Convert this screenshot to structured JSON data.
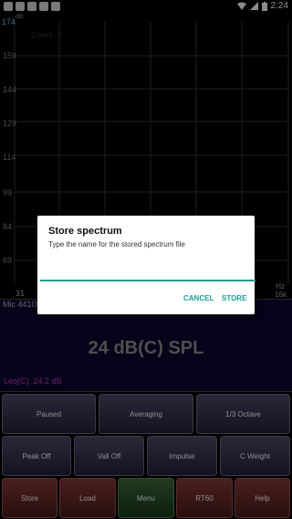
{
  "status_bar": {
    "time": "2:24"
  },
  "graph": {
    "y_top": "174",
    "y_top_unit": "dB",
    "y_ticks": [
      "159",
      "144",
      "129",
      "114",
      "99",
      "84",
      "69"
    ],
    "count": "Count: 0",
    "x_left": "31",
    "x_right_top": "Hz",
    "x_right_bottom": "16k"
  },
  "meter": {
    "mic": "Mic 44100",
    "spl": "24 dB(C) SPL",
    "leq": "Leq(C): 24.2 dB"
  },
  "buttons": {
    "row1": [
      "Paused",
      "Averaging",
      "1/3 Octave"
    ],
    "row2": [
      "Peak Off",
      "Vall Off",
      "Impulse",
      "C Weight"
    ],
    "row3": [
      "Store",
      "Load",
      "Menu",
      "RT60",
      "Help"
    ]
  },
  "dialog": {
    "title": "Store spectrum",
    "message": "Type the name for the stored spectrum file",
    "input_value": "",
    "cancel": "CANCEL",
    "store": "STORE"
  }
}
